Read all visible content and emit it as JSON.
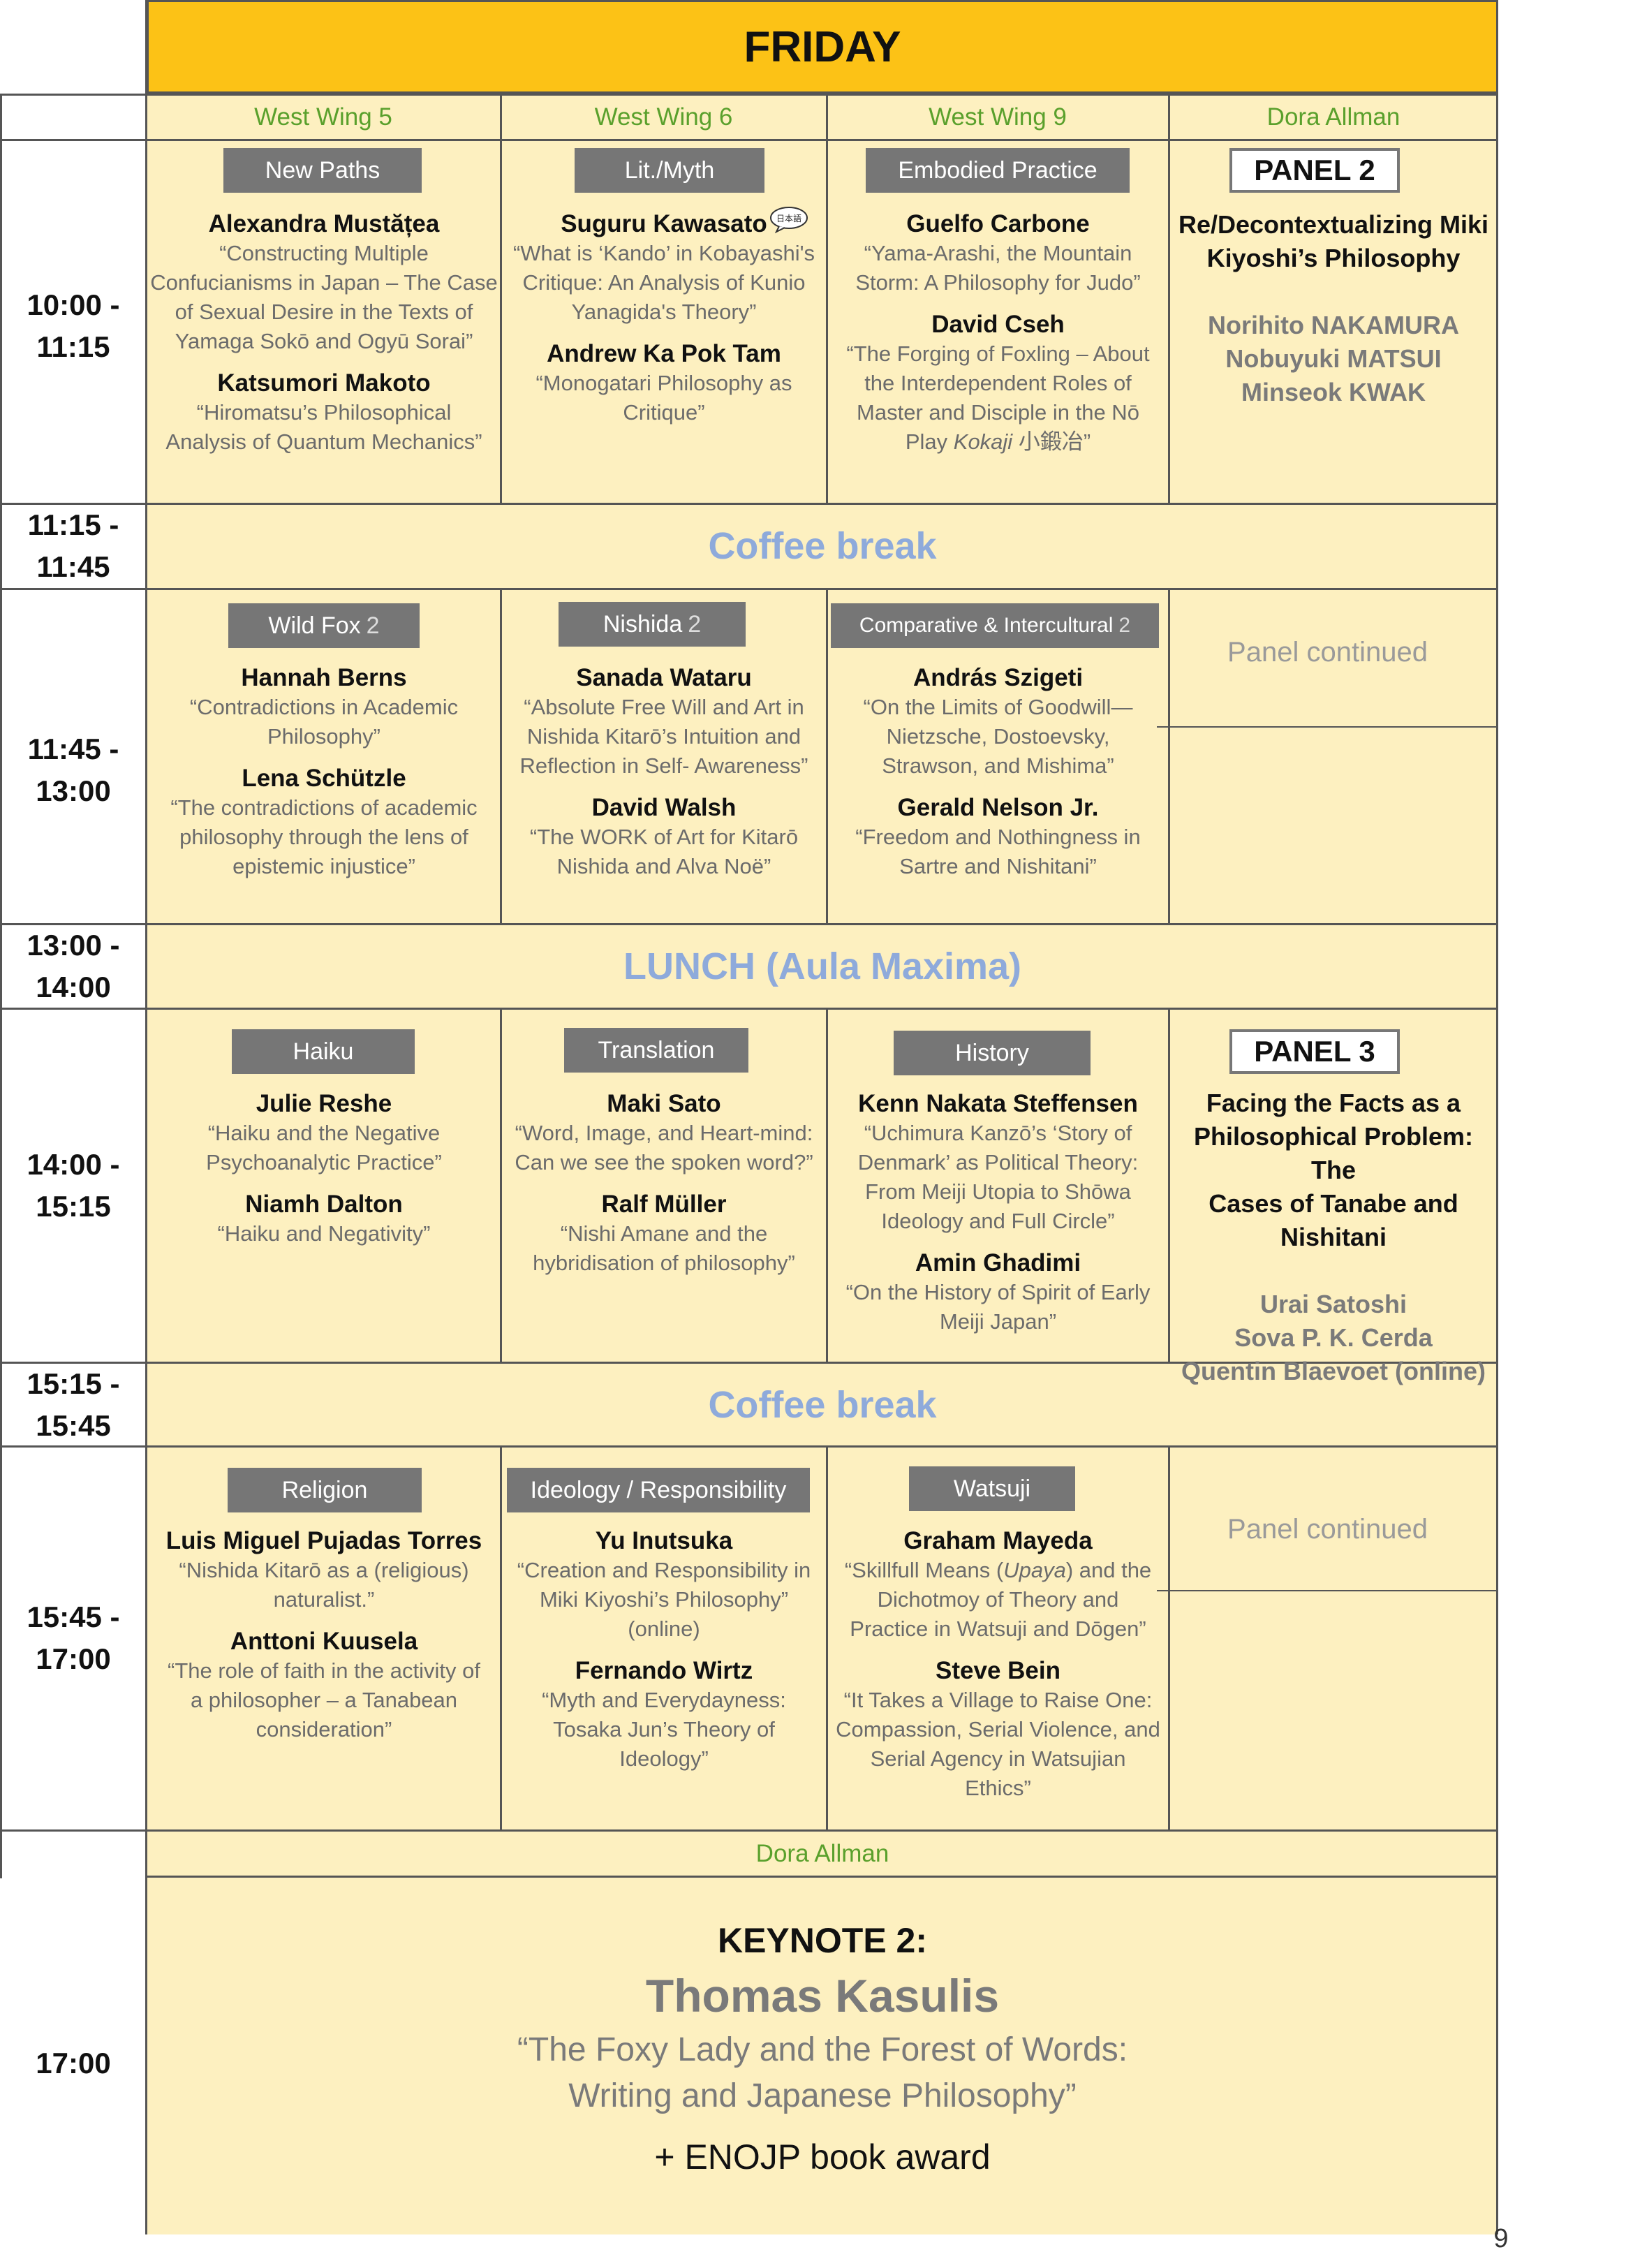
{
  "header": {
    "day": "FRIDAY"
  },
  "rooms": [
    "West Wing 5",
    "West Wing 6",
    "West Wing 9",
    "Dora Allman"
  ],
  "times": {
    "t1": [
      "10:00 -",
      "11:15"
    ],
    "t2": [
      "11:15 -",
      "11:45"
    ],
    "t3": [
      "11:45 -",
      "13:00"
    ],
    "t4": [
      "13:00 -",
      "14:00"
    ],
    "t5": [
      "14:00 -",
      "15:15"
    ],
    "t6": [
      "15:15 -",
      "15:45"
    ],
    "t7": [
      "15:45 -",
      "17:00"
    ],
    "t8": "17:00"
  },
  "block1": {
    "c1": {
      "tag": "New Paths",
      "talks": [
        {
          "name": "Alexandra Mustățea",
          "title": [
            "“Constructing Multiple",
            "Confucianisms in Japan – The Case",
            "of Sexual Desire in the Texts of",
            "Yamaga Sokō and Ogyū Sorai”"
          ]
        },
        {
          "name": "Katsumori Makoto",
          "title": [
            "“Hiromatsu’s Philosophical",
            "Analysis of Quantum Mechanics”"
          ]
        }
      ]
    },
    "c2": {
      "tag": "Lit./Myth",
      "icon_label": "日本語",
      "talks": [
        {
          "name": "Suguru Kawasato",
          "title": [
            "“What is ‘Kando’ in Kobayashi's",
            "Critique: An Analysis of Kunio",
            "Yanagida's Theory”"
          ]
        },
        {
          "name": "Andrew Ka Pok Tam",
          "title": [
            "“Monogatari Philosophy as",
            "Critique”"
          ]
        }
      ]
    },
    "c3": {
      "tag": "Embodied Practice",
      "talks": [
        {
          "name": "Guelfo Carbone",
          "title": [
            "“Yama-Arashi, the Mountain",
            "Storm: A Philosophy for Judo”"
          ]
        },
        {
          "name": "David Cseh",
          "title": [
            "“The Forging of Foxling – About",
            "the Interdependent Roles of",
            "Master and Disciple in the Nō"
          ],
          "last_pre": "Play ",
          "last_italic": "Kokaji",
          "last_post": " 小鍛冶”"
        }
      ]
    },
    "c4": {
      "tag": "PANEL 2",
      "title": [
        "Re/Decontextualizing Miki",
        "Kiyoshi’s Philosophy"
      ],
      "names": [
        "Norihito NAKAMURA",
        "Nobuyuki MATSUI",
        "Minseok KWAK"
      ]
    }
  },
  "break1": "Coffee break",
  "block2": {
    "c1": {
      "tag": "Wild Fox",
      "num": "2",
      "talks": [
        {
          "name": "Hannah Berns",
          "title": [
            "“Contradictions in Academic",
            "Philosophy”"
          ]
        },
        {
          "name": "Lena Schützle",
          "title": [
            "“The contradictions of academic",
            "philosophy through the lens of",
            "epistemic injustice”"
          ]
        }
      ]
    },
    "c2": {
      "tag": "Nishida",
      "num": "2",
      "talks": [
        {
          "name": "Sanada Wataru",
          "title": [
            "“Absolute Free Will and Art in",
            "Nishida Kitarō’s Intuition and",
            "Reflection in Self- Awareness”"
          ]
        },
        {
          "name": "David Walsh",
          "title": [
            "“The WORK of Art for Kitarō",
            "Nishida and Alva Noë”"
          ]
        }
      ]
    },
    "c3": {
      "tag": "Comparative & Intercultural",
      "num": "2",
      "talks": [
        {
          "name": "András Szigeti",
          "title": [
            "“On the Limits of Goodwill—",
            "Nietzsche, Dostoevsky,",
            "Strawson, and Mishima”"
          ]
        },
        {
          "name": "Gerald Nelson Jr.",
          "title": [
            "“Freedom and Nothingness in",
            "Sartre and Nishitani”"
          ]
        }
      ]
    },
    "c4": "Panel continued"
  },
  "lunch": "LUNCH (Aula Maxima)",
  "block3": {
    "c1": {
      "tag": "Haiku",
      "talks": [
        {
          "name": "Julie Reshe",
          "title": [
            "“Haiku and the Negative",
            "Psychoanalytic Practice”"
          ]
        },
        {
          "name": "Niamh Dalton",
          "title": [
            "“Haiku and Negativity”"
          ]
        }
      ]
    },
    "c2": {
      "tag": "Translation",
      "talks": [
        {
          "name": "Maki Sato",
          "title": [
            "“Word, Image, and Heart-mind:",
            "Can we see the spoken word?”"
          ]
        },
        {
          "name": "Ralf Müller",
          "title": [
            "“Nishi Amane and the",
            "hybridisation of philosophy”"
          ]
        }
      ]
    },
    "c3": {
      "tag": "History",
      "talks": [
        {
          "name": "Kenn Nakata Steffensen",
          "title": [
            "“Uchimura Kanzō’s ‘Story of",
            "Denmark’ as Political Theory:",
            "From Meiji Utopia to Shōwa",
            "Ideology and Full Circle”"
          ]
        },
        {
          "name": "Amin Ghadimi",
          "title": [
            "“On the History of Spirit of Early",
            "Meiji Japan”"
          ]
        }
      ]
    },
    "c4": {
      "tag": "PANEL 3",
      "title": [
        "Facing the Facts as a",
        "Philosophical Problem: The",
        "Cases of Tanabe and",
        "Nishitani"
      ],
      "names": [
        "Urai Satoshi",
        "Sova P. K. Cerda",
        "Quentin Blaevoet (online)"
      ]
    }
  },
  "break2": "Coffee break",
  "block4": {
    "c1": {
      "tag": "Religion",
      "talks": [
        {
          "name": "Luis Miguel Pujadas Torres",
          "title": [
            "“Nishida Kitarō as a (religious)",
            "naturalist.”"
          ]
        },
        {
          "name": "Anttoni Kuusela",
          "title": [
            "“The role of faith in the activity of",
            "a philosopher – a Tanabean",
            "consideration”"
          ]
        }
      ]
    },
    "c2": {
      "tag": "Ideology / Responsibility",
      "talks": [
        {
          "name": "Yu Inutsuka",
          "title": [
            "“Creation and Responsibility in",
            "Miki Kiyoshi’s Philosophy”",
            "(online)"
          ]
        },
        {
          "name": "Fernando Wirtz",
          "title": [
            "“Myth and Everydayness:",
            "Tosaka Jun’s Theory of",
            "Ideology”"
          ]
        }
      ]
    },
    "c3": {
      "tag": "Watsuji",
      "talks": [
        {
          "name": "Graham Mayeda",
          "title_pre": "“Skillfull Means (",
          "title_italic": "Upaya",
          "title_post": ") and the",
          "title": [
            "Dichotmoy of Theory and",
            "Practice in Watsuji and Dōgen”"
          ]
        },
        {
          "name": "Steve Bein",
          "title": [
            "“It Takes a Village to Raise One:",
            "Compassion, Serial Violence, and",
            "Serial Agency in Watsujian",
            "Ethics”"
          ]
        }
      ]
    },
    "c4": "Panel continued"
  },
  "keynote_room": "Dora Allman",
  "keynote": {
    "label": "KEYNOTE 2:",
    "speaker": "Thomas Kasulis",
    "title": [
      "“The Foxy Lady and the Forest of Words:",
      "Writing and Japanese Philosophy”"
    ],
    "extra": "+ ENOJP book award"
  },
  "page_number": "9"
}
